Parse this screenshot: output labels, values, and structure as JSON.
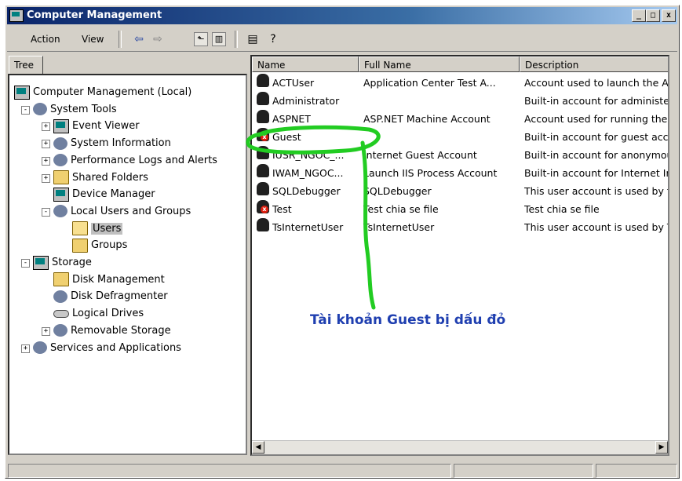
{
  "window": {
    "title": "Computer Management",
    "controls": {
      "minimize": "_",
      "maximize": "□",
      "close": "x"
    }
  },
  "menu": {
    "action": "Action",
    "view": "View"
  },
  "toolbar": {
    "icons": [
      "back-icon",
      "forward-icon",
      "up-folder-icon",
      "show-hide-tree-icon",
      "export-list-icon",
      "help-icon"
    ]
  },
  "tree": {
    "tab_label": "Tree",
    "nodes": [
      {
        "label": "Computer Management (Local)",
        "level": 0,
        "icon": "computer-icon",
        "expander": ""
      },
      {
        "label": "System Tools",
        "level": 1,
        "icon": "tools-icon",
        "expander": "-"
      },
      {
        "label": "Event Viewer",
        "level": 2,
        "icon": "event-viewer-icon",
        "expander": "+"
      },
      {
        "label": "System Information",
        "level": 2,
        "icon": "system-info-icon",
        "expander": "+"
      },
      {
        "label": "Performance Logs and Alerts",
        "level": 2,
        "icon": "performance-icon",
        "expander": "+"
      },
      {
        "label": "Shared Folders",
        "level": 2,
        "icon": "shared-folder-icon",
        "expander": "+"
      },
      {
        "label": "Device Manager",
        "level": 2,
        "icon": "device-manager-icon",
        "expander": ""
      },
      {
        "label": "Local Users and Groups",
        "level": 2,
        "icon": "users-groups-icon",
        "expander": "-"
      },
      {
        "label": "Users",
        "level": 3,
        "icon": "open-folder-icon",
        "expander": "",
        "selected": true
      },
      {
        "label": "Groups",
        "level": 3,
        "icon": "folder-icon",
        "expander": ""
      },
      {
        "label": "Storage",
        "level": 1,
        "icon": "storage-icon",
        "expander": "-"
      },
      {
        "label": "Disk Management",
        "level": 2,
        "icon": "disk-management-icon",
        "expander": ""
      },
      {
        "label": "Disk Defragmenter",
        "level": 2,
        "icon": "defragmenter-icon",
        "expander": ""
      },
      {
        "label": "Logical Drives",
        "level": 2,
        "icon": "logical-drives-icon",
        "expander": ""
      },
      {
        "label": "Removable Storage",
        "level": 2,
        "icon": "removable-storage-icon",
        "expander": "+"
      },
      {
        "label": "Services and Applications",
        "level": 1,
        "icon": "services-icon",
        "expander": "+"
      }
    ]
  },
  "list": {
    "columns": [
      "Name",
      "Full Name",
      "Description"
    ],
    "rows": [
      {
        "name": "ACTUser",
        "full_name": "Application Center Test A...",
        "description": "Account used to launch the Ap",
        "disabled": false
      },
      {
        "name": "Administrator",
        "full_name": "",
        "description": "Built-in account for administer",
        "disabled": false
      },
      {
        "name": "ASPNET",
        "full_name": "ASP.NET Machine Account",
        "description": "Account used for running the A",
        "disabled": false
      },
      {
        "name": "Guest",
        "full_name": "",
        "description": "Built-in account for guest acco",
        "disabled": true
      },
      {
        "name": "IUSR_NGOC_...",
        "full_name": "Internet Guest Account",
        "description": "Built-in account for anonymou",
        "disabled": false
      },
      {
        "name": "IWAM_NGOC...",
        "full_name": "Launch IIS Process Account",
        "description": "Built-in account for Internet Ir",
        "disabled": false
      },
      {
        "name": "SQLDebugger",
        "full_name": "SQLDebugger",
        "description": "This user account is used by tl",
        "disabled": false
      },
      {
        "name": "Test",
        "full_name": "Test chia se file",
        "description": "Test chia se file",
        "disabled": true
      },
      {
        "name": "TsInternetUser",
        "full_name": "TsInternetUser",
        "description": "This user account is used by T",
        "disabled": false
      }
    ]
  },
  "annotation": {
    "text": "Tài khoản Guest bị dấu đỏ",
    "color": "#1f3fb0",
    "stroke_color": "#22cc22"
  },
  "colors": {
    "titlebar_start": "#0a246a",
    "titlebar_end": "#a6caf0",
    "face": "#d4d0c8"
  }
}
